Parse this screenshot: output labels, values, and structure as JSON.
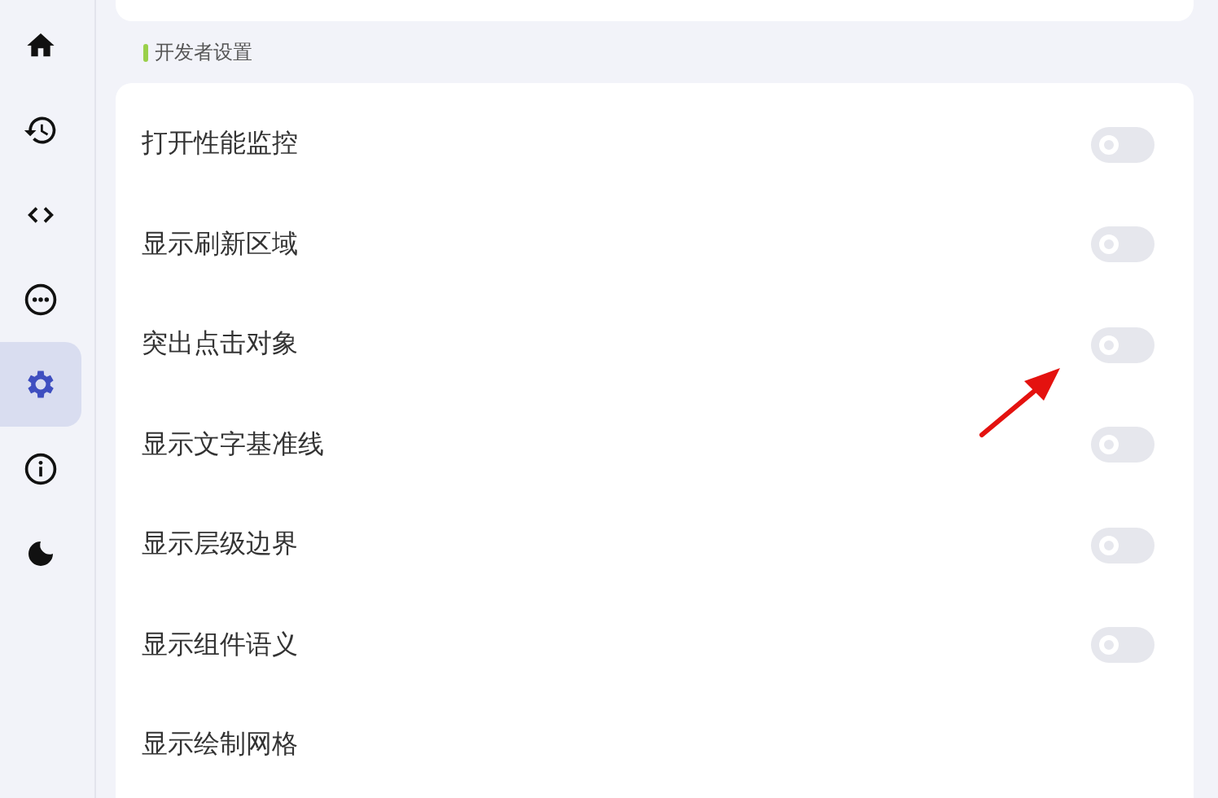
{
  "sidebar": {
    "items": [
      {
        "kind": "home",
        "selected": false
      },
      {
        "kind": "history",
        "selected": false
      },
      {
        "kind": "code",
        "selected": false
      },
      {
        "kind": "more",
        "selected": false
      },
      {
        "kind": "settings",
        "selected": true
      },
      {
        "kind": "info",
        "selected": false
      },
      {
        "kind": "moon",
        "selected": false
      }
    ]
  },
  "section": {
    "title": "开发者设置",
    "rows": [
      {
        "label": "打开性能监控",
        "on": false
      },
      {
        "label": "显示刷新区域",
        "on": false
      },
      {
        "label": "突出点击对象",
        "on": false
      },
      {
        "label": "显示文字基准线",
        "on": false
      },
      {
        "label": "显示层级边界",
        "on": false
      },
      {
        "label": "显示组件语义",
        "on": false
      },
      {
        "label": "显示绘制网格"
      }
    ]
  }
}
